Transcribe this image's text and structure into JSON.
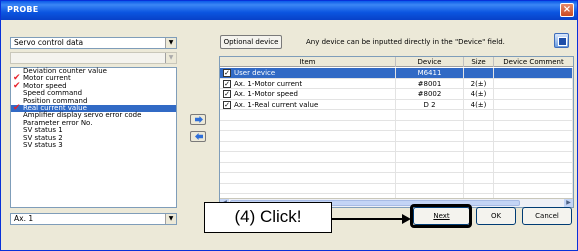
{
  "window": {
    "title": "PROBE",
    "close_glyph": "×"
  },
  "left_panel": {
    "category_select": {
      "value": "Servo control data"
    },
    "sub_select": {
      "value": ""
    },
    "items": [
      {
        "label": "Deviation counter value",
        "checked": false,
        "selected": false
      },
      {
        "label": "Motor current",
        "checked": true,
        "selected": false
      },
      {
        "label": "Motor speed",
        "checked": true,
        "selected": false
      },
      {
        "label": "Speed command",
        "checked": false,
        "selected": false
      },
      {
        "label": "Position command",
        "checked": false,
        "selected": false
      },
      {
        "label": "Real current value",
        "checked": true,
        "selected": true
      },
      {
        "label": "Amplifier display servo error code",
        "checked": false,
        "selected": false
      },
      {
        "label": "Parameter error No.",
        "checked": false,
        "selected": false
      },
      {
        "label": "SV status 1",
        "checked": false,
        "selected": false
      },
      {
        "label": "SV status 2",
        "checked": false,
        "selected": false
      },
      {
        "label": "SV status 3",
        "checked": false,
        "selected": false
      }
    ],
    "axis_select": {
      "value": "Ax. 1"
    }
  },
  "toolbar": {
    "optional_device_label": "Optional device",
    "info_text": "Any device can be inputted directly in the \"Device\" field."
  },
  "grid": {
    "columns": [
      "Item",
      "Device",
      "Size",
      "Device Comment"
    ],
    "rows": [
      {
        "item": "User device",
        "device": "M6411",
        "size": "",
        "comment": "",
        "checked": true,
        "selected": true
      },
      {
        "item": "Ax. 1-Motor current",
        "device": "#8001",
        "size": "2(±)",
        "comment": "",
        "checked": true,
        "selected": false
      },
      {
        "item": "Ax. 1-Motor speed",
        "device": "#8002",
        "size": "4(±)",
        "comment": "",
        "checked": true,
        "selected": false
      },
      {
        "item": "Ax. 1-Real current value",
        "device": "D  2",
        "size": "4(±)",
        "comment": "",
        "checked": true,
        "selected": false
      }
    ]
  },
  "buttons": {
    "next": "Next",
    "ok": "OK",
    "cancel": "Cancel"
  },
  "annotation": {
    "callout_text": "(4) Click!"
  },
  "colors": {
    "selection": "#316ac5",
    "check_mark": "#e8202a",
    "titlebar": "#0a5ae8"
  }
}
